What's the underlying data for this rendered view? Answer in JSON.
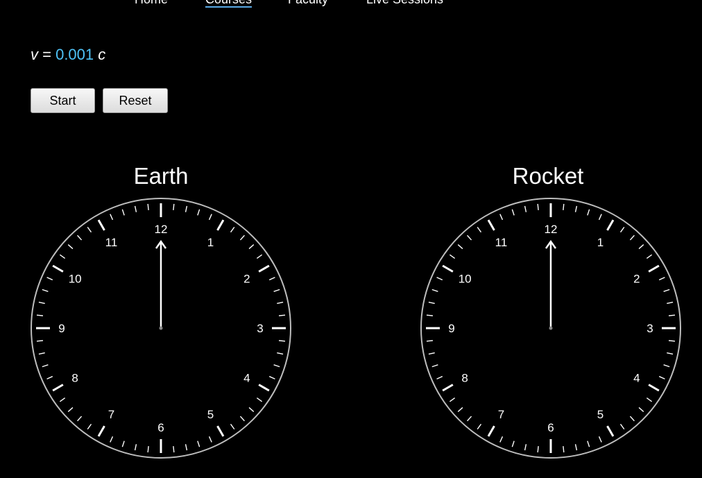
{
  "nav": {
    "items": [
      {
        "label": "Home"
      },
      {
        "label": "Courses"
      },
      {
        "label": "Faculty"
      },
      {
        "label": "Live Sessions"
      }
    ]
  },
  "velocity": {
    "var": "v",
    "equals": " = ",
    "value": "0.001",
    "unit": "c"
  },
  "controls": {
    "start_label": "Start",
    "reset_label": "Reset"
  },
  "clocks": [
    {
      "title": "Earth",
      "hour": 12,
      "minute": 0,
      "second": 0
    },
    {
      "title": "Rocket",
      "hour": 12,
      "minute": 0,
      "second": 0
    }
  ],
  "dial_numbers": [
    "12",
    "1",
    "2",
    "3",
    "4",
    "5",
    "6",
    "7",
    "8",
    "9",
    "10",
    "11"
  ],
  "colors": {
    "background": "#000000",
    "foreground": "#ffffff",
    "accent": "#4fc3f7",
    "dial_border": "#bdbdbd"
  }
}
